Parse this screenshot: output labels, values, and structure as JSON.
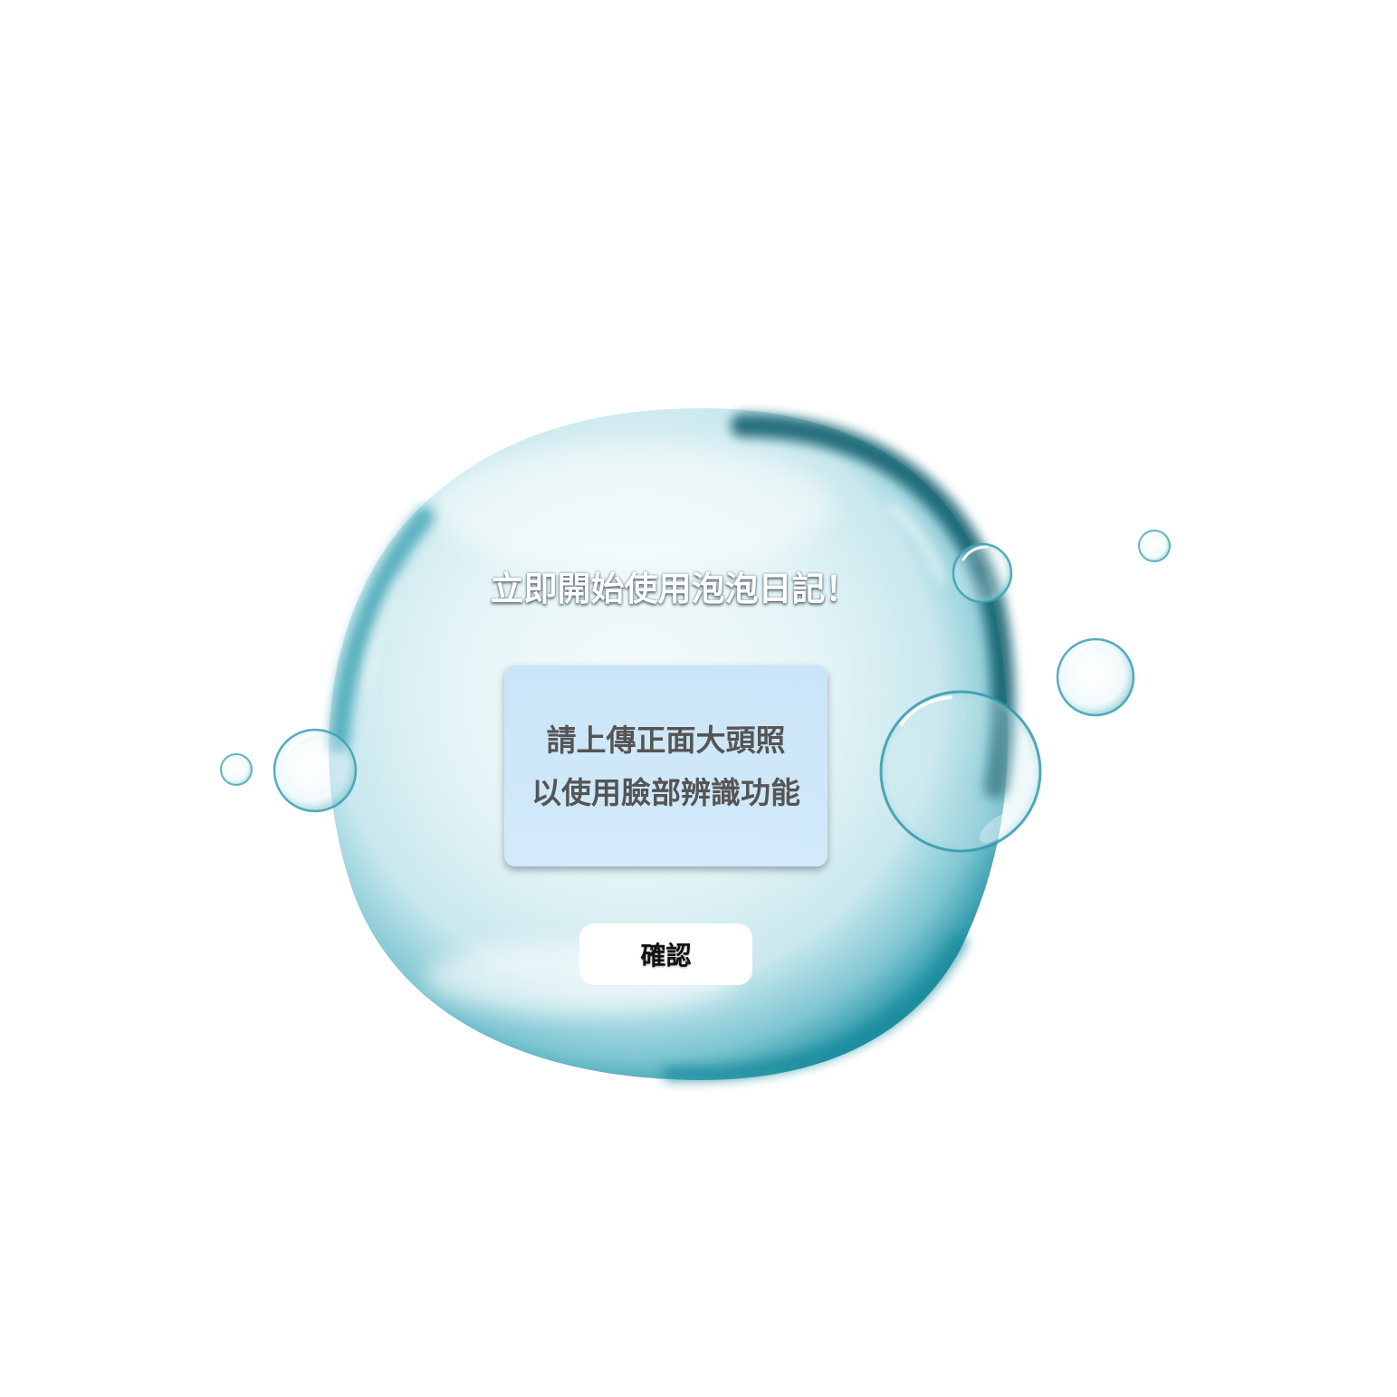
{
  "dialog": {
    "title": "立即開始使用泡泡日記！",
    "message_lines": [
      "請上傳正面大頭照",
      "以使用臉部辨識功能"
    ],
    "confirm_label": "確認"
  },
  "colors": {
    "bubble_edge": "#1e8fa0",
    "bubble_fill": "#d8eef2",
    "panel_bg": "#cfe6f8",
    "message_text": "#555555",
    "button_bg": "#ffffff"
  }
}
